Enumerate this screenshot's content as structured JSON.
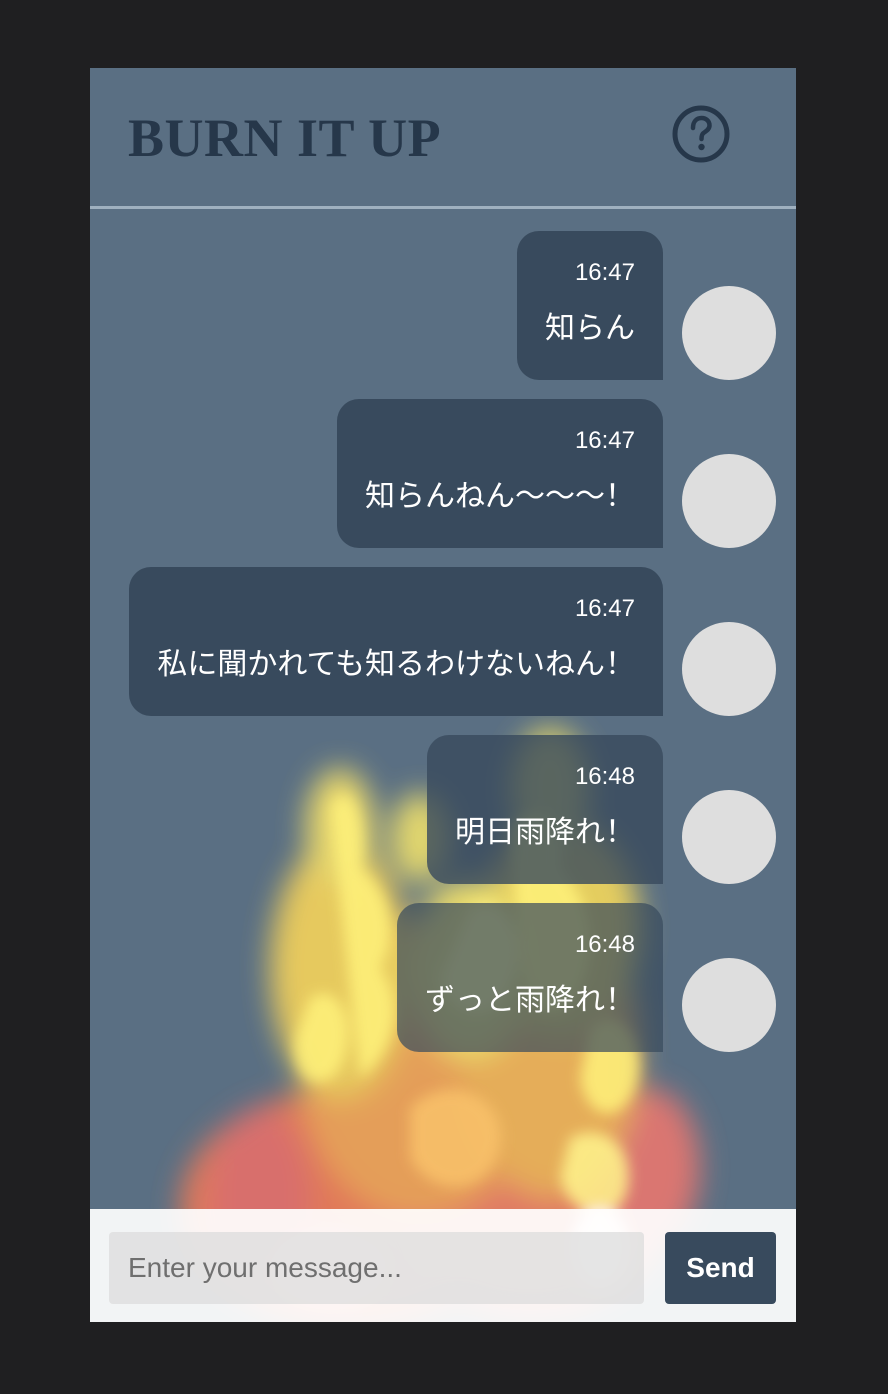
{
  "app": {
    "title": "BURN IT UP",
    "help_icon": "question-circle-icon"
  },
  "messages": [
    {
      "time": "16:47",
      "text": "知らん"
    },
    {
      "time": "16:47",
      "text": "知らんねん〜〜〜！"
    },
    {
      "time": "16:47",
      "text": "私に聞かれても知るわけないねん！"
    },
    {
      "time": "16:48",
      "text": "明日雨降れ！"
    },
    {
      "time": "16:48",
      "text": "ずっと雨降れ！"
    }
  ],
  "composer": {
    "placeholder": "Enter your message...",
    "send_label": "Send"
  },
  "colors": {
    "frame": "#1f1f21",
    "app_background": "#5a6f83",
    "bubble": "#384a5d",
    "title": "#26374a",
    "avatar": "#dedede"
  }
}
